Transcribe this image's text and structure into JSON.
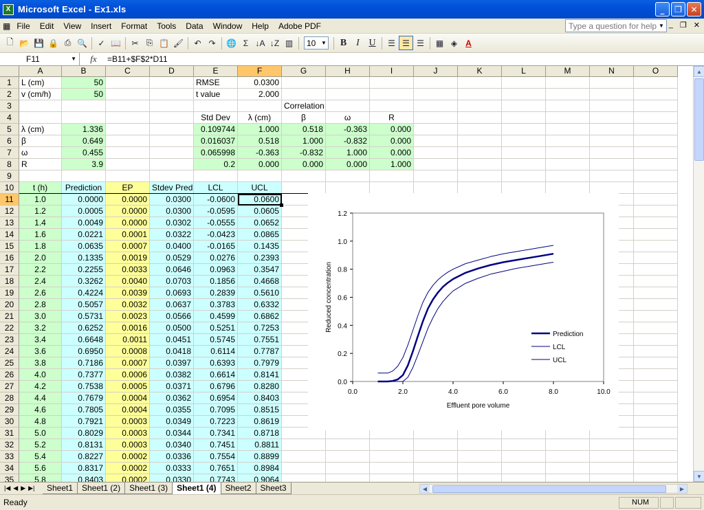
{
  "window": {
    "title": "Microsoft Excel - Ex1.xls",
    "icon": "excel-icon"
  },
  "menu": [
    "File",
    "Edit",
    "View",
    "Insert",
    "Format",
    "Tools",
    "Data",
    "Window",
    "Help",
    "Adobe PDF"
  ],
  "help_placeholder": "Type a question for help",
  "toolbar": {
    "font_size": "10",
    "bold": "B",
    "italic": "I",
    "underline": "U"
  },
  "formula_bar": {
    "name_box": "F11",
    "fx": "fx",
    "formula": "=B11+$F$2*D11"
  },
  "columns": [
    "A",
    "B",
    "C",
    "D",
    "E",
    "F",
    "G",
    "H",
    "I",
    "J",
    "K",
    "L",
    "M",
    "N",
    "O"
  ],
  "rows": [
    "1",
    "2",
    "3",
    "4",
    "5",
    "6",
    "7",
    "8",
    "9",
    "10",
    "11",
    "12",
    "13",
    "14",
    "15",
    "16",
    "17",
    "18",
    "19",
    "20",
    "21",
    "22",
    "23",
    "24",
    "25",
    "26",
    "27",
    "28",
    "29",
    "30",
    "31",
    "32",
    "33",
    "34",
    "35"
  ],
  "params": {
    "A1": "L (cm)",
    "B1": "50",
    "A2": "v (cm/h)",
    "B2": "50",
    "A5": "λ (cm)",
    "B5": "1.336",
    "A6": "β",
    "B6": "0.649",
    "A7": "ω",
    "B7": "0.455",
    "A8": "R",
    "B8": "3.9"
  },
  "stats": {
    "E1": "RMSE",
    "F1": "0.0300",
    "E2": "t value",
    "F2": "2.000",
    "G3": "Correlation",
    "E4": "Std Dev",
    "F4": "λ (cm)",
    "G4": "β",
    "H4": "ω",
    "I4": "R",
    "matrix": [
      [
        "0.109744",
        "1.000",
        "0.518",
        "-0.363",
        "0.000"
      ],
      [
        "0.016037",
        "0.518",
        "1.000",
        "-0.832",
        "0.000"
      ],
      [
        "0.065998",
        "-0.363",
        "-0.832",
        "1.000",
        "0.000"
      ],
      [
        "0.2",
        "0.000",
        "0.000",
        "0.000",
        "1.000"
      ]
    ]
  },
  "table": {
    "headers": [
      "t (h)",
      "Prediction",
      "EP",
      "Stdev Pred",
      "LCL",
      "UCL"
    ],
    "rows": [
      [
        "1.0",
        "0.0000",
        "0.0000",
        "0.0300",
        "-0.0600",
        "0.0600"
      ],
      [
        "1.2",
        "0.0005",
        "0.0000",
        "0.0300",
        "-0.0595",
        "0.0605"
      ],
      [
        "1.4",
        "0.0049",
        "0.0000",
        "0.0302",
        "-0.0555",
        "0.0652"
      ],
      [
        "1.6",
        "0.0221",
        "0.0001",
        "0.0322",
        "-0.0423",
        "0.0865"
      ],
      [
        "1.8",
        "0.0635",
        "0.0007",
        "0.0400",
        "-0.0165",
        "0.1435"
      ],
      [
        "2.0",
        "0.1335",
        "0.0019",
        "0.0529",
        "0.0276",
        "0.2393"
      ],
      [
        "2.2",
        "0.2255",
        "0.0033",
        "0.0646",
        "0.0963",
        "0.3547"
      ],
      [
        "2.4",
        "0.3262",
        "0.0040",
        "0.0703",
        "0.1856",
        "0.4668"
      ],
      [
        "2.6",
        "0.4224",
        "0.0039",
        "0.0693",
        "0.2839",
        "0.5610"
      ],
      [
        "2.8",
        "0.5057",
        "0.0032",
        "0.0637",
        "0.3783",
        "0.6332"
      ],
      [
        "3.0",
        "0.5731",
        "0.0023",
        "0.0566",
        "0.4599",
        "0.6862"
      ],
      [
        "3.2",
        "0.6252",
        "0.0016",
        "0.0500",
        "0.5251",
        "0.7253"
      ],
      [
        "3.4",
        "0.6648",
        "0.0011",
        "0.0451",
        "0.5745",
        "0.7551"
      ],
      [
        "3.6",
        "0.6950",
        "0.0008",
        "0.0418",
        "0.6114",
        "0.7787"
      ],
      [
        "3.8",
        "0.7186",
        "0.0007",
        "0.0397",
        "0.6393",
        "0.7979"
      ],
      [
        "4.0",
        "0.7377",
        "0.0006",
        "0.0382",
        "0.6614",
        "0.8141"
      ],
      [
        "4.2",
        "0.7538",
        "0.0005",
        "0.0371",
        "0.6796",
        "0.8280"
      ],
      [
        "4.4",
        "0.7679",
        "0.0004",
        "0.0362",
        "0.6954",
        "0.8403"
      ],
      [
        "4.6",
        "0.7805",
        "0.0004",
        "0.0355",
        "0.7095",
        "0.8515"
      ],
      [
        "4.8",
        "0.7921",
        "0.0003",
        "0.0349",
        "0.7223",
        "0.8619"
      ],
      [
        "5.0",
        "0.8029",
        "0.0003",
        "0.0344",
        "0.7341",
        "0.8718"
      ],
      [
        "5.2",
        "0.8131",
        "0.0003",
        "0.0340",
        "0.7451",
        "0.8811"
      ],
      [
        "5.4",
        "0.8227",
        "0.0002",
        "0.0336",
        "0.7554",
        "0.8899"
      ],
      [
        "5.6",
        "0.8317",
        "0.0002",
        "0.0333",
        "0.7651",
        "0.8984"
      ],
      [
        "5.8",
        "0.8403",
        "0.0002",
        "0.0330",
        "0.7743",
        "0.9064"
      ]
    ]
  },
  "chart_data": {
    "type": "line",
    "xlabel": "Effluent pore volume",
    "ylabel": "Reduced concentration",
    "xlim": [
      0,
      10
    ],
    "ylim": [
      0,
      1.2
    ],
    "xticks": [
      "0.0",
      "2.0",
      "4.0",
      "6.0",
      "8.0",
      "10.0"
    ],
    "yticks": [
      "0.0",
      "0.2",
      "0.4",
      "0.6",
      "0.8",
      "1.0",
      "1.2"
    ],
    "legend_position": "bottom-right",
    "series": [
      {
        "name": "Prediction",
        "x": [
          1.0,
          1.4,
          1.6,
          1.8,
          2.0,
          2.2,
          2.4,
          2.6,
          2.8,
          3.0,
          3.2,
          3.4,
          3.6,
          3.8,
          4.0,
          4.5,
          5.0,
          5.5,
          6.0,
          6.5,
          7.0,
          7.5,
          8.0
        ],
        "y": [
          0.0,
          0.0,
          0.004,
          0.015,
          0.045,
          0.115,
          0.215,
          0.325,
          0.43,
          0.52,
          0.585,
          0.635,
          0.675,
          0.705,
          0.73,
          0.775,
          0.805,
          0.83,
          0.85,
          0.865,
          0.88,
          0.895,
          0.91
        ]
      },
      {
        "name": "LCL",
        "x": [
          1.0,
          1.4,
          1.6,
          1.8,
          2.0,
          2.2,
          2.4,
          2.6,
          2.8,
          3.0,
          3.2,
          3.4,
          3.6,
          3.8,
          4.0,
          4.5,
          5.0,
          5.5,
          6.0,
          6.5,
          7.0,
          7.5,
          8.0
        ],
        "y": [
          0.0,
          0.0,
          0.0,
          0.0,
          0.0,
          0.03,
          0.1,
          0.19,
          0.285,
          0.38,
          0.455,
          0.52,
          0.57,
          0.61,
          0.645,
          0.7,
          0.735,
          0.765,
          0.785,
          0.805,
          0.82,
          0.835,
          0.85
        ]
      },
      {
        "name": "UCL",
        "x": [
          1.0,
          1.4,
          1.6,
          1.8,
          2.0,
          2.2,
          2.4,
          2.6,
          2.8,
          3.0,
          3.2,
          3.4,
          3.6,
          3.8,
          4.0,
          4.5,
          5.0,
          5.5,
          6.0,
          6.5,
          7.0,
          7.5,
          8.0
        ],
        "y": [
          0.06,
          0.06,
          0.075,
          0.11,
          0.17,
          0.26,
          0.365,
          0.47,
          0.565,
          0.635,
          0.685,
          0.725,
          0.755,
          0.78,
          0.8,
          0.84,
          0.865,
          0.89,
          0.91,
          0.925,
          0.94,
          0.955,
          0.97
        ]
      }
    ]
  },
  "sheet_tabs": [
    "Sheet1",
    "Sheet1 (2)",
    "Sheet1 (3)",
    "Sheet1 (4)",
    "Sheet2",
    "Sheet3"
  ],
  "active_tab": "Sheet1 (4)",
  "status": {
    "ready": "Ready",
    "num": "NUM"
  },
  "colors": {
    "green": "#ccffcc",
    "yellow": "#ffff99",
    "cyan": "#ccffff",
    "selection": "#ffc76a",
    "title_blue": "#0050d8",
    "line_color": "#000080"
  }
}
